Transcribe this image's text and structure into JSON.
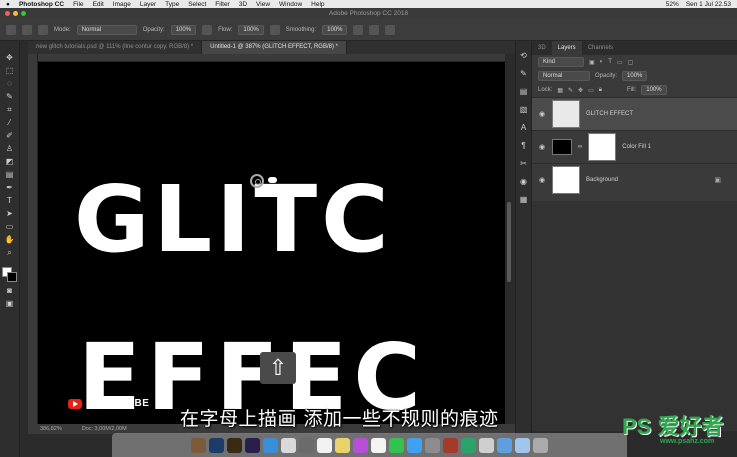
{
  "menubar": {
    "apple": "",
    "app": "Photoshop CC",
    "items": [
      "File",
      "Edit",
      "Image",
      "Layer",
      "Type",
      "Select",
      "Filter",
      "3D",
      "View",
      "Window",
      "Help"
    ],
    "battery": "52%",
    "clock": "Sen 1 Jul  22.53"
  },
  "window": {
    "title": "Adobe Photoshop CC 2018"
  },
  "options": {
    "mode_label": "Mode:",
    "mode_value": "Normal",
    "opacity_label": "Opacity:",
    "opacity_value": "100%",
    "flow_label": "Flow:",
    "flow_value": "100%",
    "smoothing_label": "Smoothing:",
    "smoothing_value": "100%"
  },
  "tabs": [
    {
      "label": "new glitch tutorials.psd @ 111% (line contur copy, RGB/8) *"
    },
    {
      "label": "Untitled-1 @ 387% (GLITCH EFFECT, RGB/8) *"
    }
  ],
  "canvas": {
    "line1": "GLITC",
    "line2": "EFFEC"
  },
  "status": {
    "zoom": "386,82%",
    "doc": "Doc: 3,00M/2,00M"
  },
  "subscribe": "SUBSCRIBE",
  "subtitle": "在字母上描画 添加一些不规则的痕迹",
  "layers_panel": {
    "tabs": [
      "3D",
      "Layers",
      "Channels"
    ],
    "kind": "Kind",
    "blend": "Normal",
    "opacity_label": "Opacity:",
    "opacity_value": "100%",
    "lock_label": "Lock:",
    "fill_label": "Fill:",
    "fill_value": "100%",
    "layers": [
      {
        "name": "GLITCH EFFECT"
      },
      {
        "name": "Color Fill 1"
      },
      {
        "name": "Background"
      }
    ]
  },
  "watermark": {
    "logo": "PS 爱好者",
    "url": "www.psahz.com"
  },
  "colors": {
    "fg_swatch": "#ffffff",
    "bg_swatch": "#000000",
    "youtube_red": "#e62117",
    "watermark_green": "#2fa84f"
  }
}
